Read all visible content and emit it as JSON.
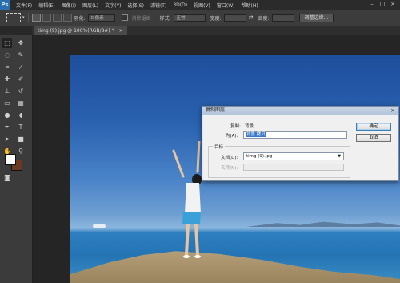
{
  "app": {
    "logo": "Ps"
  },
  "menubar": {
    "items": [
      "文件(F)",
      "编辑(E)",
      "图像(I)",
      "图层(L)",
      "文字(Y)",
      "选择(S)",
      "滤镜(T)",
      "3D(D)",
      "视图(V)",
      "窗口(W)",
      "帮助(H)"
    ],
    "window_controls": [
      "–",
      "□",
      "×"
    ]
  },
  "options_bar": {
    "feather_label": "羽化:",
    "feather_value": "0 像素",
    "antialias_label": "消除锯齿",
    "style_label": "样式:",
    "style_value": "正常",
    "width_label": "宽度:",
    "height_label": "高度:",
    "refine_edge_button": "调整边缘..."
  },
  "document": {
    "tab_title": "timg (9).jpg @ 100%(RGB/8#) *"
  },
  "dialog": {
    "title": "复制图层",
    "copy_label": "复制:",
    "copy_value": "背景",
    "as_label": "为(A):",
    "as_value": "背景 拷贝",
    "group_label": "目标",
    "document_label": "文档(D):",
    "document_value": "timg (9).jpg",
    "name_label": "名称(N):",
    "ok_button": "确定",
    "cancel_button": "取消",
    "close_glyph": "×"
  }
}
